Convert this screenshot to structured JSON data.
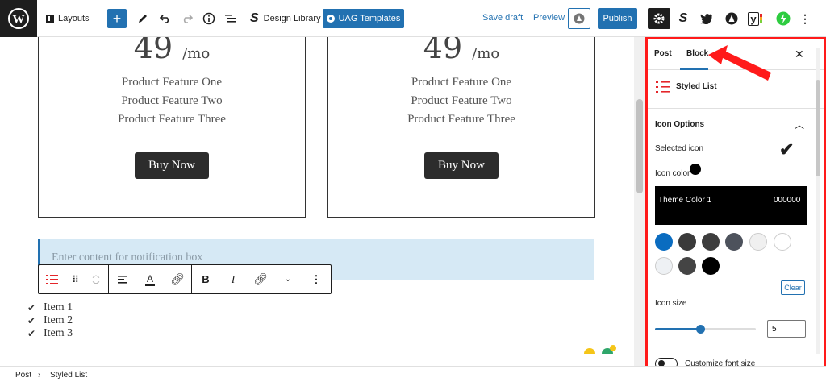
{
  "topbar": {
    "layouts_label": "Layouts",
    "design_library_label": "Design Library",
    "uag_templates_label": "UAG Templates",
    "save_draft_label": "Save draft",
    "preview_label": "Preview",
    "publish_label": "Publish"
  },
  "pricing": [
    {
      "price": "49",
      "period": "/mo",
      "features": [
        "Product Feature One",
        "Product Feature Two",
        "Product Feature Three"
      ],
      "button": "Buy Now"
    },
    {
      "price": "49",
      "period": "/mo",
      "features": [
        "Product Feature One",
        "Product Feature Two",
        "Product Feature Three"
      ],
      "button": "Buy Now"
    }
  ],
  "notification": {
    "placeholder": "Enter content for notification box"
  },
  "list": {
    "items": [
      "Item 1",
      "Item 2",
      "Item 3"
    ]
  },
  "sidebar": {
    "tabs": [
      "Post",
      "Block"
    ],
    "active_tab": "Block",
    "close_symbol": "✕",
    "block_name": "Styled List",
    "panel_title": "Icon Options",
    "selected_icon_label": "Selected icon",
    "icon_color_label": "Icon color",
    "theme_color_name": "Theme Color 1",
    "theme_color_hex": "000000",
    "swatches": [
      "#0a6cc0",
      "#3a3a3a",
      "#3d3d3d",
      "#4d525c",
      "#f0f0f0",
      "#ffffff",
      "#eef1f4",
      "#444444",
      "#000000"
    ],
    "clear_label": "Clear",
    "icon_size_label": "Icon size",
    "icon_size_value": "5",
    "icon_size_fraction": 0.45,
    "customize_font_label": "Customize font size"
  },
  "footer": {
    "breadcrumb": [
      "Post",
      "Styled List"
    ],
    "separator": "›"
  },
  "colors": {
    "accent": "#2271b1",
    "highlight": "#ff1a1a"
  }
}
